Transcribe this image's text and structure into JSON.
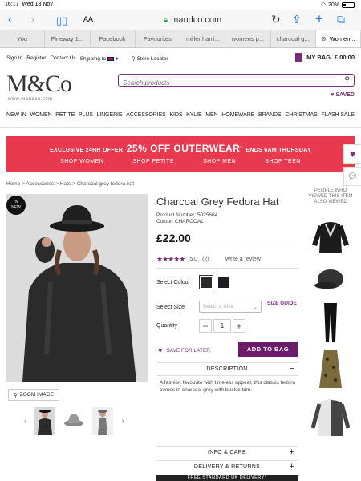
{
  "status": {
    "time": "16:17",
    "date": "Wed 13 Nov",
    "battery": "20%"
  },
  "safari": {
    "aa": "AA",
    "url": "mandco.com"
  },
  "tabs": [
    {
      "label": "You"
    },
    {
      "label": "Fineway 1..."
    },
    {
      "label": "Facebook"
    },
    {
      "label": "Favourites"
    },
    {
      "label": "miller harri..."
    },
    {
      "label": "womens p..."
    },
    {
      "label": "charcoal g..."
    },
    {
      "label": "Women..."
    }
  ],
  "toplinks": {
    "signin": "Sign In",
    "register": "Register",
    "contact": "Contact Us",
    "shipping": "Shipping to",
    "store": "Store Locator"
  },
  "bag": {
    "label": "MY BAG",
    "amount": "£ 00.00"
  },
  "logo": {
    "text": "M&Co",
    "url": "www.mandco.com"
  },
  "search": {
    "placeholder": "Search products"
  },
  "saved": "SAVED",
  "nav": [
    "NEW IN",
    "WOMEN",
    "PETITE",
    "PLUS",
    "LINGERIE",
    "ACCESSORIES",
    "KIDS",
    "KYLIE",
    "MEN",
    "HOMEWARE",
    "BRANDS",
    "CHRISTMAS",
    "FLASH SALE"
  ],
  "banner": {
    "prefix": "EXCLUSIVE 24HR OFFER",
    "headline": "25% OFF OUTERWEAR",
    "suffix": "ENDS 6AM THURSDAY",
    "links": [
      "SHOP WOMEN",
      "SHOP PETITE",
      "SHOP MEN",
      "SHOP TEEN"
    ],
    "view": "*VIEW"
  },
  "breadcrumb": "Home > Accessories > Hats > Charcoal grey fedora hat",
  "badge": {
    "line1": "I'M",
    "line2": "NEW"
  },
  "zoom": "ZOOM IMAGE",
  "product": {
    "title": "Charcoal Grey Fedora Hat",
    "number": "Product Number: 5025664",
    "colour": "Colour: CHARCOAL",
    "price": "£22.00",
    "rating_value": "5.0",
    "rating_count": "(2)",
    "review_link": "Write a review"
  },
  "options": {
    "colour_label": "Select Colour",
    "size_label": "Select Size",
    "size_placeholder": "Select a Size",
    "size_guide": "SIZE GUIDE",
    "quantity_label": "Quantity",
    "quantity": "1"
  },
  "actions": {
    "save_later": "SAVE FOR LATER",
    "add_to_bag": "ADD TO BAG"
  },
  "accordion": {
    "description": "DESCRIPTION",
    "description_text": "A fashion favourite with timeless appeal, this classic fedora comes in charcoal grey with buckle trim.",
    "info": "INFO & CARE",
    "delivery": "DELIVERY & RETURNS"
  },
  "free_delivery": "FREE STANDARD UK DELIVERY*",
  "people_who_viewed": "PEOPLE WHO VIEWED THIS ITEM ALSO VIEWED",
  "colors": {
    "brand": "#7c2b7b",
    "banner": "#e8394f"
  }
}
